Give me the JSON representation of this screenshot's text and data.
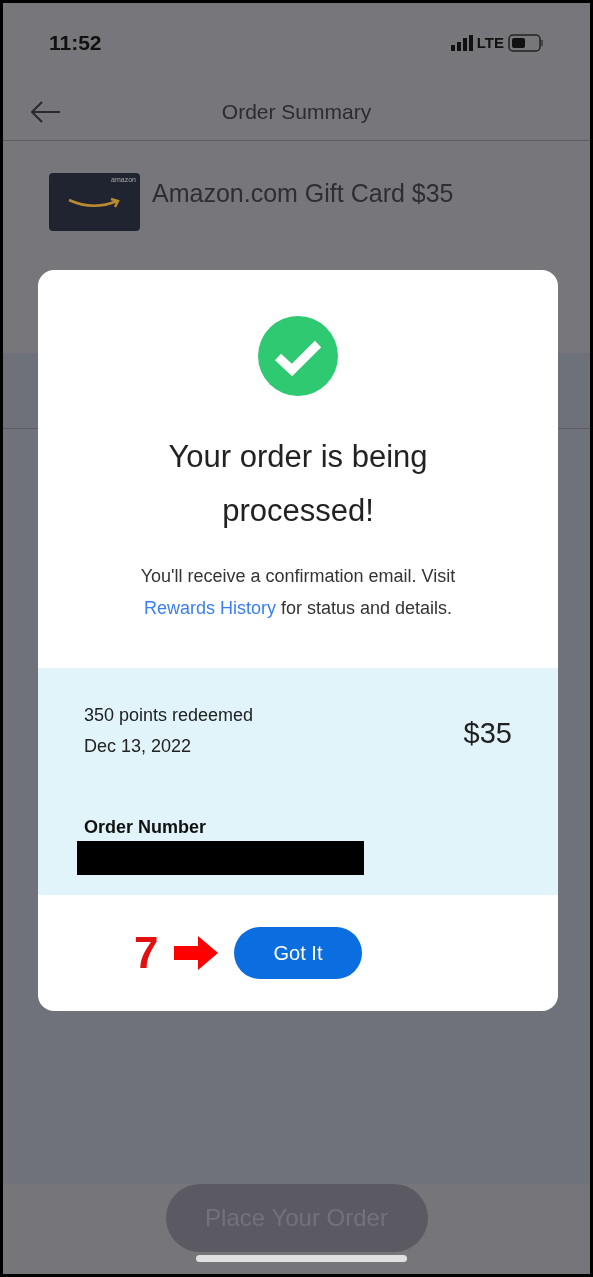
{
  "status_bar": {
    "time": "11:52",
    "network": "LTE"
  },
  "header": {
    "title": "Order Summary"
  },
  "product": {
    "name": "Amazon.com Gift Card $35",
    "card_brand": "amazon"
  },
  "footer": {
    "button": "Place Your Order",
    "disabled": true
  },
  "dialog": {
    "title": "Your order is being processed!",
    "message": "You'll receive a confirmation email. Visit ",
    "link": "Rewards History",
    "message_end": " for status and details.",
    "points": "350 points redeemed",
    "date": "Dec 13, 2022",
    "amount": "$35",
    "order_number_label": "Order Number",
    "order_number_redacted": true,
    "button": "Got It"
  },
  "annotation": {
    "step": "7"
  }
}
